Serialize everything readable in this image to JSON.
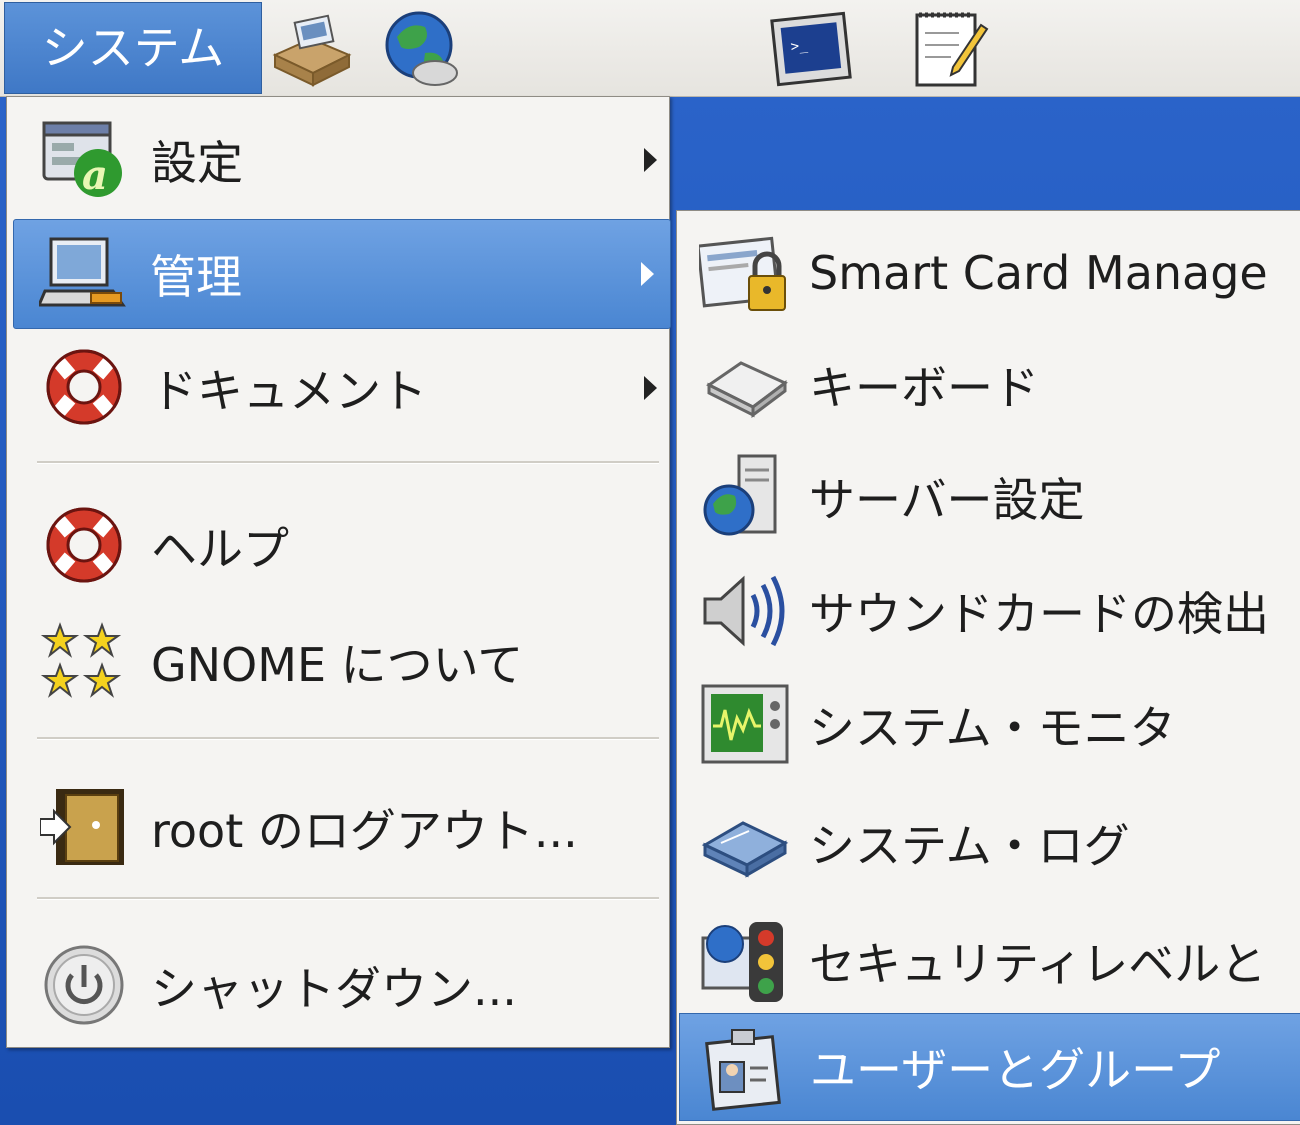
{
  "panel": {
    "menu_label": "システム",
    "launchers": [
      "package-icon",
      "network-globe-icon",
      "terminal-icon",
      "text-editor-icon"
    ]
  },
  "main_menu": {
    "items": [
      {
        "label": "設定",
        "icon": "preferences-icon",
        "has_submenu": true
      },
      {
        "label": "管理",
        "icon": "administration-icon",
        "has_submenu": true,
        "highlighted": true
      },
      {
        "label": "ドキュメント",
        "icon": "help-lifebuoy-icon",
        "has_submenu": true
      },
      {
        "label": "ヘルプ",
        "icon": "help-lifebuoy-icon"
      },
      {
        "label": "GNOME について",
        "icon": "gnome-stars-icon"
      },
      {
        "label": "root のログアウト...",
        "icon": "logout-door-icon"
      },
      {
        "label": "シャットダウン...",
        "icon": "power-icon"
      }
    ]
  },
  "sub_menu": {
    "items": [
      {
        "label": "Smart Card Manage",
        "icon": "smart-card-lock-icon"
      },
      {
        "label": "キーボード",
        "icon": "keyboard-icon"
      },
      {
        "label": "サーバー設定",
        "icon": "server-globe-icon"
      },
      {
        "label": "サウンドカードの検出",
        "icon": "speaker-icon"
      },
      {
        "label": "システム・モニタ",
        "icon": "system-monitor-icon"
      },
      {
        "label": "システム・ログ",
        "icon": "log-book-icon"
      },
      {
        "label": "セキュリティレベルと",
        "icon": "security-traffic-icon"
      },
      {
        "label": "ユーザーとグループ",
        "icon": "users-groups-icon",
        "highlighted": true
      }
    ]
  },
  "colors": {
    "highlight": "#4a86d2",
    "desktop": "#1f55b8",
    "menu_bg": "#f5f4f2"
  }
}
